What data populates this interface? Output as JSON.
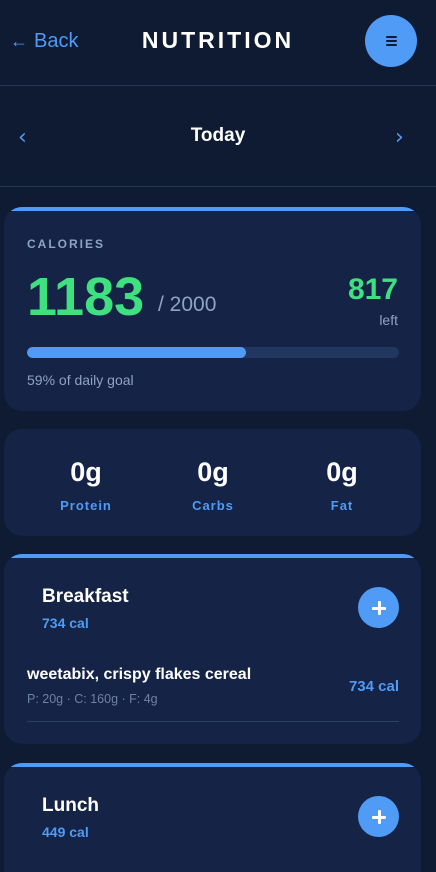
{
  "header": {
    "back_arrow": "←",
    "back_label": "Back",
    "title": "NUTRITION",
    "menu_icon": "hamburger-menu-icon"
  },
  "date_nav": {
    "prev_glyph": "‹",
    "label": "Today",
    "next_glyph": "›"
  },
  "calories": {
    "label": "CALORIES",
    "consumed": "1183",
    "goal_text": "/ 2000",
    "left_value": "817",
    "left_label": "left",
    "progress_fraction": 0.59,
    "progress_text": "59% of daily goal"
  },
  "macros": [
    {
      "value": "0g",
      "label": "Protein"
    },
    {
      "value": "0g",
      "label": "Carbs"
    },
    {
      "value": "0g",
      "label": "Fat"
    }
  ],
  "meals": [
    {
      "name": "Breakfast",
      "calories": "734 cal",
      "items": [
        {
          "name": "weetabix, crispy flakes cereal",
          "macros": "P: 20g · C: 160g · F: 4g",
          "calories": "734 cal"
        }
      ]
    },
    {
      "name": "Lunch",
      "calories": "449 cal",
      "items": []
    }
  ],
  "colors": {
    "background": "#0f1a33",
    "card": "#142346",
    "accent": "#4f9bf5",
    "positive": "#3ee07f",
    "muted": "#8fa3c5"
  }
}
